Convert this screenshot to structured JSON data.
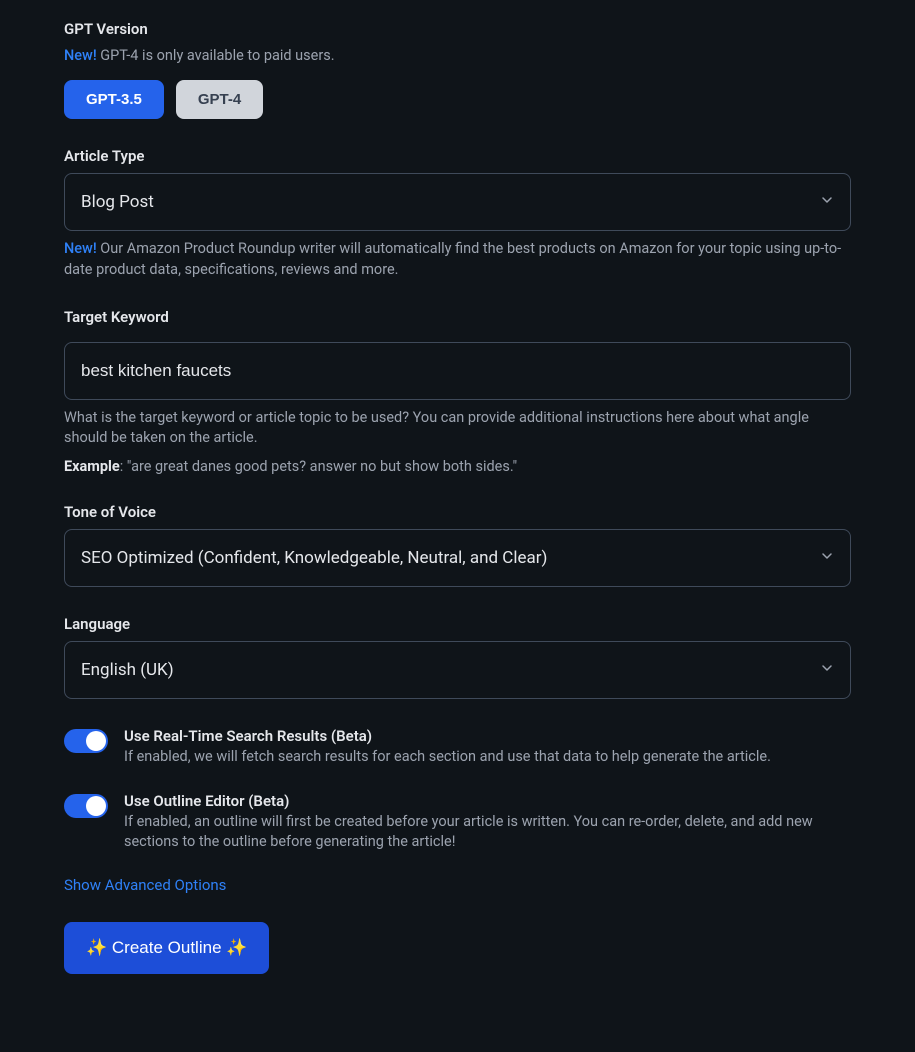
{
  "gptVersion": {
    "label": "GPT Version",
    "newBadge": "New!",
    "helperText": " GPT-4 is only available to paid users.",
    "options": {
      "gpt35": "GPT-3.5",
      "gpt4": "GPT-4"
    }
  },
  "articleType": {
    "label": "Article Type",
    "value": "Blog Post",
    "newBadge": "New!",
    "helperText": " Our Amazon Product Roundup writer will automatically find the best products on Amazon for your topic using up-to-date product data, specifications, reviews and more."
  },
  "targetKeyword": {
    "label": "Target Keyword",
    "value": "best kitchen faucets",
    "helperText": "What is the target keyword or article topic to be used? You can provide additional instructions here about what angle should be taken on the article.",
    "exampleLabel": "Example",
    "exampleText": ": \"are great danes good pets? answer no but show both sides.\""
  },
  "toneOfVoice": {
    "label": "Tone of Voice",
    "value": "SEO Optimized (Confident, Knowledgeable, Neutral, and Clear)"
  },
  "language": {
    "label": "Language",
    "value": "English (UK)"
  },
  "toggles": {
    "realTime": {
      "title": "Use Real-Time Search Results (Beta)",
      "desc": "If enabled, we will fetch search results for each section and use that data to help generate the article."
    },
    "outlineEditor": {
      "title": "Use Outline Editor (Beta)",
      "desc": "If enabled, an outline will first be created before your article is written. You can re-order, delete, and add new sections to the outline before generating the article!"
    }
  },
  "advancedLink": "Show Advanced Options",
  "createButton": "Create Outline"
}
